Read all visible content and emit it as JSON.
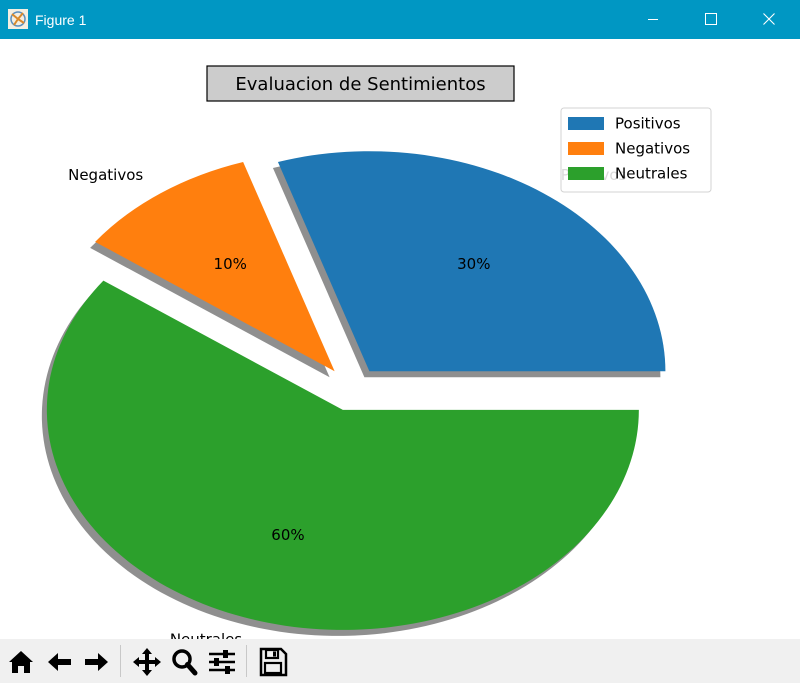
{
  "window": {
    "title": "Figure 1",
    "accent": "#0097c3"
  },
  "chart_data": {
    "type": "pie",
    "title": "Evaluacion de Sentimientos",
    "categories": [
      "Positivos",
      "Negativos",
      "Neutrales"
    ],
    "values": [
      30,
      10,
      60
    ],
    "percent_labels": [
      "30%",
      "10%",
      "60%"
    ],
    "explode": [
      0.1,
      0.1,
      0.1
    ],
    "colors": [
      "#1f77b4",
      "#ff7f0e",
      "#2ca02c"
    ],
    "shadow": true,
    "legend": {
      "placement": "top-right",
      "entries": [
        "Positivos",
        "Negativos",
        "Neutrales"
      ]
    }
  },
  "toolbar": {
    "buttons": [
      "home-icon",
      "back-icon",
      "forward-icon",
      "pan-icon",
      "zoom-icon",
      "configure-subplots-icon",
      "save-icon"
    ]
  }
}
